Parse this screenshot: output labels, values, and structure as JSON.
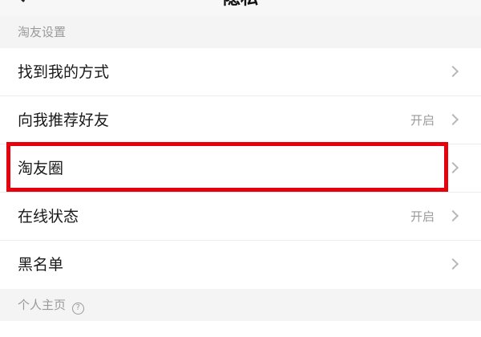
{
  "header": {
    "title": "隐私"
  },
  "sections": {
    "friends": {
      "title": "淘友设置",
      "items": [
        {
          "label": "找到我的方式",
          "value": ""
        },
        {
          "label": "向我推荐好友",
          "value": "开启"
        },
        {
          "label": "淘友圈",
          "value": ""
        },
        {
          "label": "在线状态",
          "value": "开启"
        },
        {
          "label": "黑名单",
          "value": ""
        }
      ]
    },
    "profile": {
      "title": "个人主页",
      "help_icon": "?"
    }
  },
  "colors": {
    "highlight": "#e6000e",
    "background": "#f4f4f4"
  }
}
